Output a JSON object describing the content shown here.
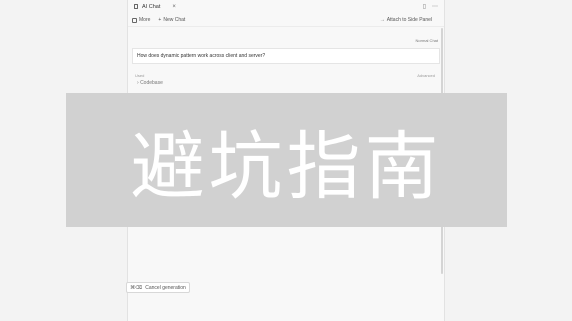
{
  "tab": {
    "title": "AI Chat",
    "close_glyph": "×"
  },
  "tabbar": {
    "split_icon": "split-icon",
    "more_icon": "more-icon"
  },
  "toolbar": {
    "more_label": "More",
    "new_chat_label": "New Chat",
    "attach_label": "Attach to Side Panel"
  },
  "chat": {
    "mode": "Normal Chat",
    "question": "How does dynamic pattern work across client and server?",
    "meta_left": "Used",
    "meta_right": "Advanced",
    "codebase_label": "Codebase"
  },
  "cancel": {
    "shortcut": "⌘⌫",
    "label": "Cancel generation"
  },
  "overlay": {
    "text": "避坑指南"
  }
}
